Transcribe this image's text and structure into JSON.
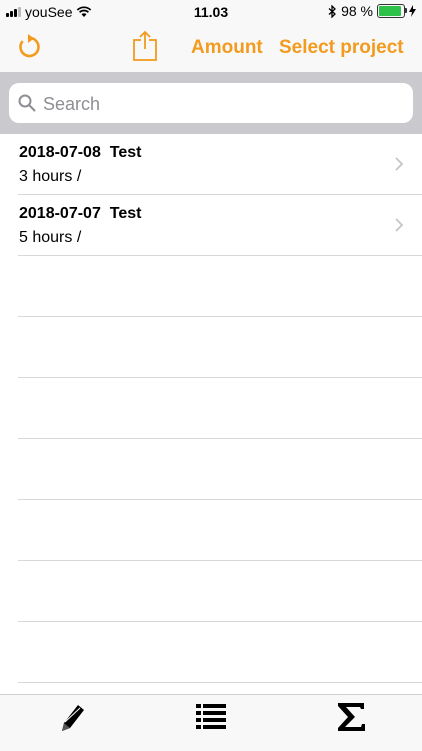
{
  "status_bar": {
    "carrier": "youSee",
    "time": "11.03",
    "battery": "98 %",
    "battery_level": 0.98
  },
  "nav": {
    "refresh_icon": "refresh-icon",
    "share_icon": "share-icon",
    "amount_label": "Amount",
    "select_project_label": "Select project"
  },
  "search": {
    "placeholder": "Search",
    "value": ""
  },
  "entries": [
    {
      "title": "2018-07-08  Test",
      "subtitle": "3 hours /"
    },
    {
      "title": "2018-07-07  Test",
      "subtitle": "5 hours /"
    }
  ],
  "tab_bar": {
    "tabs": [
      "pencil-icon",
      "list-icon",
      "sigma-icon"
    ]
  },
  "colors": {
    "accent": "#f29b1e",
    "search_background": "#c9c9ce"
  }
}
